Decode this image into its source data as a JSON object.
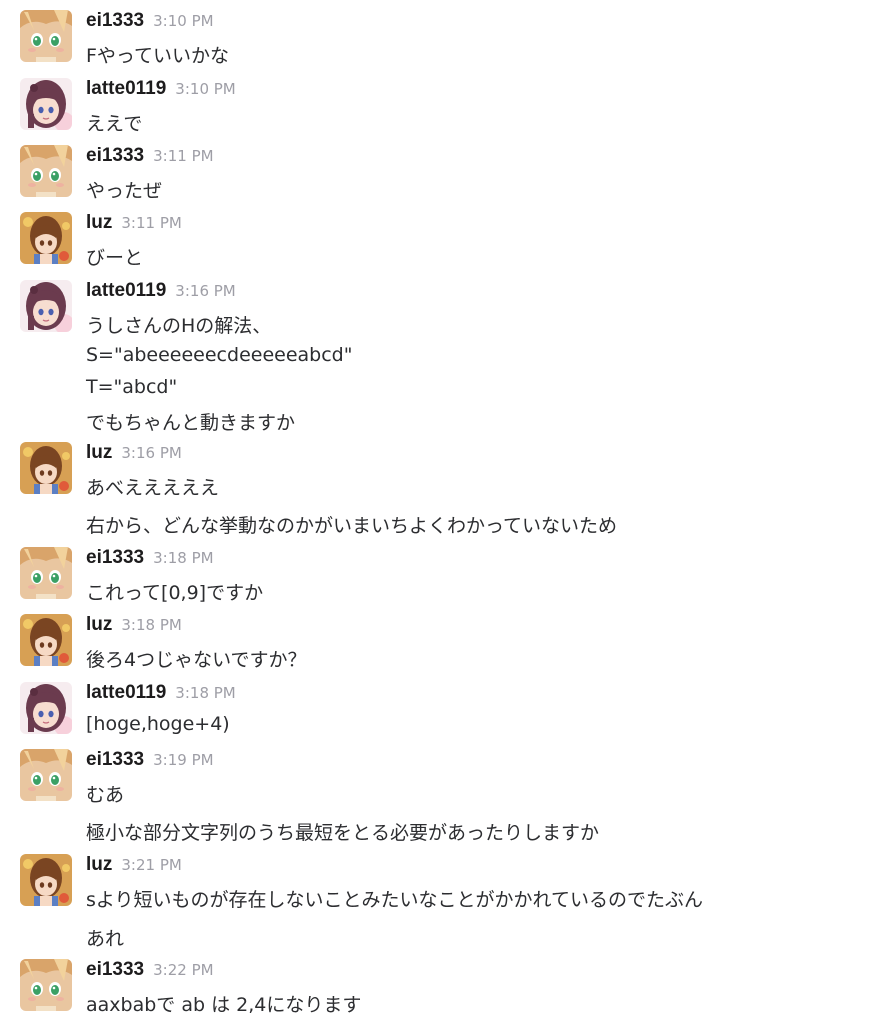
{
  "messages": [
    {
      "user": "ei1333",
      "avatar": "ei1333-avatar",
      "time": "3:10 PM",
      "lines": [
        "Fやっていいかな"
      ]
    },
    {
      "user": "latte0119",
      "avatar": "latte0119-avatar",
      "time": "3:10 PM",
      "lines": [
        "ええで"
      ]
    },
    {
      "user": "ei1333",
      "avatar": "ei1333-avatar",
      "time": "3:11 PM",
      "lines": [
        "やったぜ"
      ]
    },
    {
      "user": "luz",
      "avatar": "luz-avatar",
      "time": "3:11 PM",
      "lines": [
        "びーと"
      ]
    },
    {
      "user": "latte0119",
      "avatar": "latte0119-avatar",
      "time": "3:16 PM",
      "lines": [
        "うしさんのHの解法、",
        "S=\"abeeeeeecdeeeeeabcd\"",
        "T=\"abcd\"",
        "でもちゃんと動きますか"
      ]
    },
    {
      "user": "luz",
      "avatar": "luz-avatar",
      "time": "3:16 PM",
      "lines": [
        "あべえええええ",
        "右から、どんな挙動なのかがいまいちよくわかっていないため"
      ]
    },
    {
      "user": "ei1333",
      "avatar": "ei1333-avatar",
      "time": "3:18 PM",
      "lines": [
        "これって[0,9]ですか"
      ]
    },
    {
      "user": "luz",
      "avatar": "luz-avatar",
      "time": "3:18 PM",
      "lines": [
        "後ろ4つじゃないですか？"
      ]
    },
    {
      "user": "latte0119",
      "avatar": "latte0119-avatar",
      "time": "3:18 PM",
      "lines": [
        "[hoge,hoge+4)"
      ]
    },
    {
      "user": "ei1333",
      "avatar": "ei1333-avatar",
      "time": "3:19 PM",
      "lines": [
        "むあ",
        "極小な部分文字列のうち最短をとる必要があったりしますか"
      ]
    },
    {
      "user": "luz",
      "avatar": "luz-avatar",
      "time": "3:21 PM",
      "lines": [
        "sより短いものが存在しないことみたいなことがかかれているのでたぶん",
        "あれ"
      ]
    },
    {
      "user": "ei1333",
      "avatar": "ei1333-avatar",
      "time": "3:22 PM",
      "lines": [
        "aaxbabで ab は 2,4になります"
      ]
    }
  ]
}
